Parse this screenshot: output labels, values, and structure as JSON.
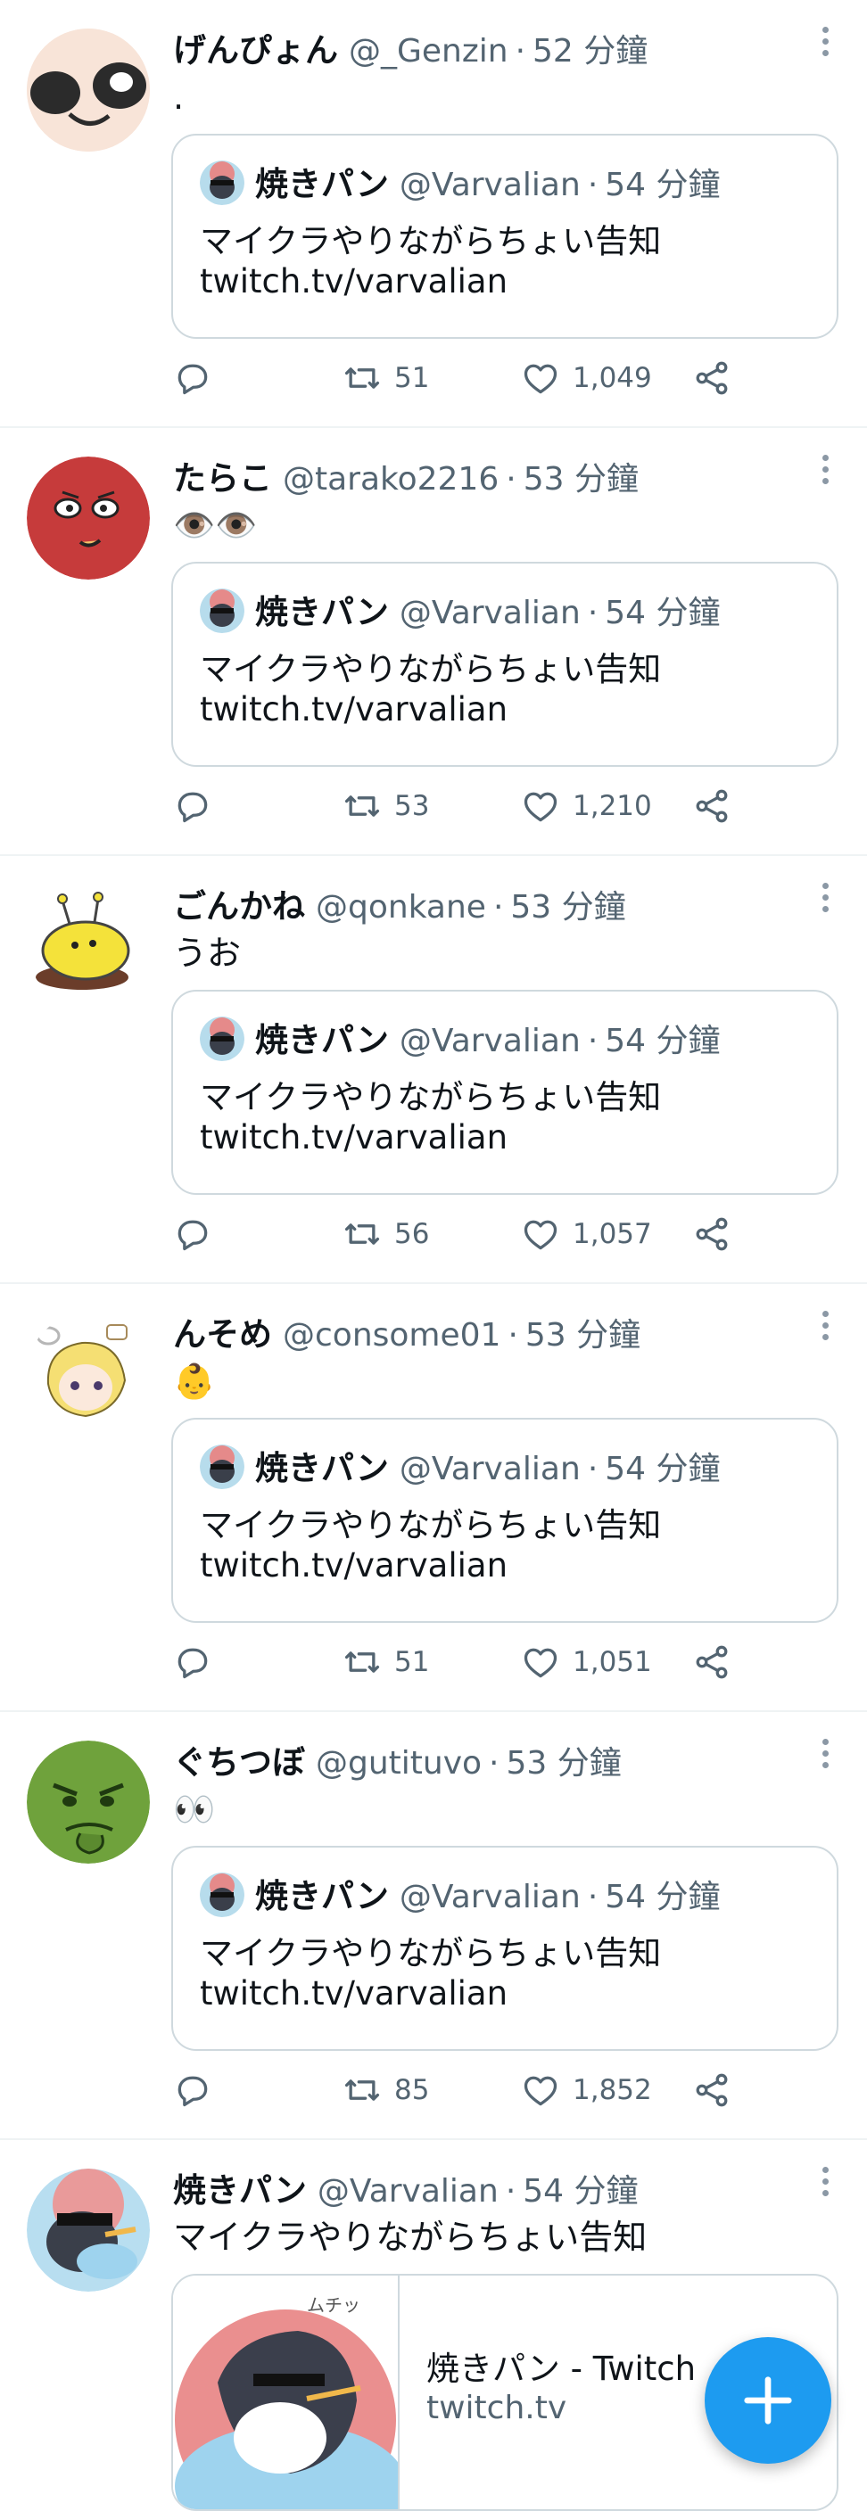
{
  "tweets": [
    {
      "name": "げんぴょん",
      "handle": "@_Genzin",
      "sep": "·",
      "time": "52 分鐘",
      "text": ".",
      "quote": {
        "name": "焼きパン",
        "handle": "@Varvalian",
        "sep": "·",
        "time": "54 分鐘",
        "line1": "マイクラやりながらちょい告知",
        "line2": "twitch.tv/varvalian"
      },
      "retweets": "51",
      "likes": "1,049"
    },
    {
      "name": "たらこ",
      "handle": "@tarako2216",
      "sep": "·",
      "time": "53 分鐘",
      "text": "👁️👁️",
      "quote": {
        "name": "焼きパン",
        "handle": "@Varvalian",
        "sep": "·",
        "time": "54 分鐘",
        "line1": "マイクラやりながらちょい告知",
        "line2": "twitch.tv/varvalian"
      },
      "retweets": "53",
      "likes": "1,210"
    },
    {
      "name": "ごんかね",
      "handle": "@qonkane",
      "sep": "·",
      "time": "53 分鐘",
      "text": "うお",
      "quote": {
        "name": "焼きパン",
        "handle": "@Varvalian",
        "sep": "·",
        "time": "54 分鐘",
        "line1": "マイクラやりながらちょい告知",
        "line2": "twitch.tv/varvalian"
      },
      "retweets": "56",
      "likes": "1,057"
    },
    {
      "name": "んそめ",
      "handle": "@consome01",
      "sep": "·",
      "time": "53 分鐘",
      "text": "👶",
      "quote": {
        "name": "焼きパン",
        "handle": "@Varvalian",
        "sep": "·",
        "time": "54 分鐘",
        "line1": "マイクラやりながらちょい告知",
        "line2": "twitch.tv/varvalian"
      },
      "retweets": "51",
      "likes": "1,051"
    },
    {
      "name": "ぐちつぼ",
      "handle": "@gutituvo",
      "sep": "·",
      "time": "53 分鐘",
      "text": "👀",
      "quote": {
        "name": "焼きパン",
        "handle": "@Varvalian",
        "sep": "·",
        "time": "54 分鐘",
        "line1": "マイクラやりながらちょい告知",
        "line2": "twitch.tv/varvalian"
      },
      "retweets": "85",
      "likes": "1,852"
    }
  ],
  "last": {
    "name": "焼きパン",
    "handle": "@Varvalian",
    "sep": "·",
    "time": "54 分鐘",
    "text": "マイクラやりながらちょい告知",
    "card": {
      "title": "焼きパン - Twitch",
      "domain": "twitch.tv",
      "image_text": "ムチッ"
    }
  },
  "icons": {
    "reply": "reply-icon",
    "retweet": "retweet-icon",
    "like": "heart-icon",
    "share": "share-icon",
    "more": "more-icon",
    "compose": "plus-icon"
  },
  "colors": {
    "accent": "#1d9bf0",
    "secondary_text": "#536471",
    "border": "#cfd9de"
  }
}
